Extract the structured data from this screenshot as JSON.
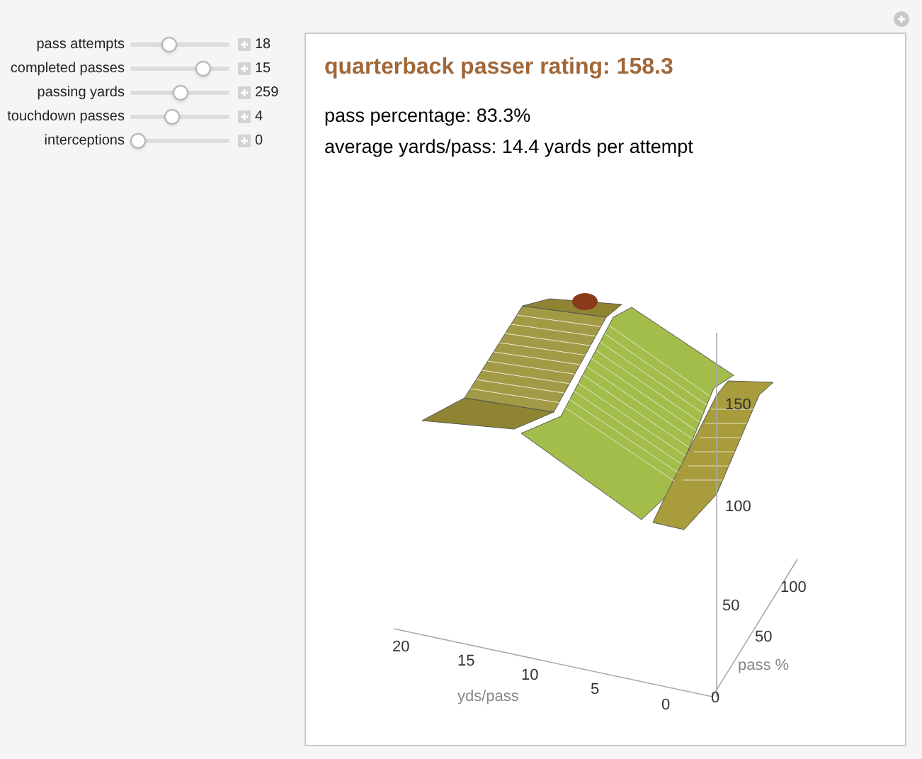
{
  "sliders": [
    {
      "label": "pass attempts",
      "level": 0.37,
      "value": "18"
    },
    {
      "label": "completed passes",
      "level": 0.78,
      "value": "15"
    },
    {
      "label": "passing yards",
      "level": 0.5,
      "value": "259"
    },
    {
      "label": "touchdown passes",
      "level": 0.4,
      "value": "4"
    },
    {
      "label": "interceptions",
      "level": 0,
      "value": "0"
    }
  ],
  "panel": {
    "title": "quarterback passer rating: 158.3",
    "lines": [
      "pass percentage: 83.3%",
      "average yards/pass: 14.4 yards per attempt"
    ]
  },
  "plot": {
    "z_ticks": [
      "150",
      "100",
      "50"
    ],
    "x_ticks": [
      "20",
      "15",
      "10",
      "5",
      "0"
    ],
    "x_label": "yds/pass",
    "y_ticks": [
      "0",
      "50",
      "100"
    ],
    "y_label": "pass %"
  }
}
